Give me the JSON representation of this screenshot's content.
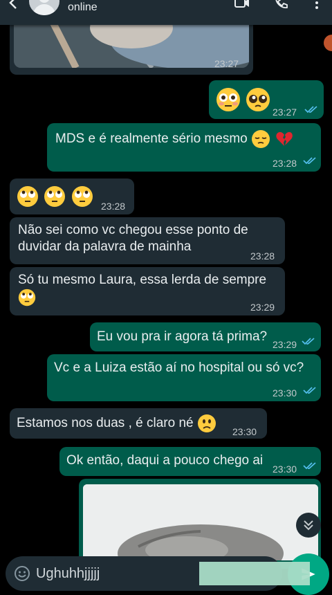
{
  "header": {
    "status": "online"
  },
  "colors": {
    "incoming_bubble": "#1f2c34",
    "outgoing_bubble": "#005c4b",
    "read_ticks": "#53bdeb",
    "background": "#000000"
  },
  "messages": [
    {
      "direction": "in",
      "type": "image",
      "time": "23:27"
    },
    {
      "direction": "out",
      "type": "emoji",
      "text": "",
      "emojis": [
        "flushed-face",
        "pleading-face"
      ],
      "time": "23:27",
      "status": "read"
    },
    {
      "direction": "out",
      "type": "text",
      "text": "MDS e é realmente sério mesmo",
      "emojis": [
        "pensive-face",
        "broken-heart"
      ],
      "time": "23:28",
      "status": "read"
    },
    {
      "direction": "in",
      "type": "emoji",
      "emojis": [
        "face-with-rolling-eyes",
        "face-with-rolling-eyes",
        "face-with-rolling-eyes"
      ],
      "time": "23:28"
    },
    {
      "direction": "in",
      "type": "text",
      "text": "Não sei como vc chegou esse ponto de duvidar da palavra de mainha",
      "time": "23:28"
    },
    {
      "direction": "in",
      "type": "text",
      "text": "Só tu mesmo Laura,  essa lerda de sempre",
      "emojis": [
        "face-with-rolling-eyes"
      ],
      "time": "23:29"
    },
    {
      "direction": "out",
      "type": "text",
      "text": "Eu vou pra ir agora tá prima?",
      "time": "23:29",
      "status": "read"
    },
    {
      "direction": "out",
      "type": "text",
      "text": "Vc e a Luiza estão aí no hospital ou só vc?",
      "time": "23:30",
      "status": "read"
    },
    {
      "direction": "in",
      "type": "text",
      "text": "Estamos nos duas , é claro né",
      "emojis": [
        "slightly-frowning-face"
      ],
      "time": "23:30"
    },
    {
      "direction": "out",
      "type": "text",
      "text": "Ok então, daqui a pouco chego ai",
      "time": "23:30",
      "status": "read"
    },
    {
      "direction": "out",
      "type": "image"
    }
  ],
  "composer": {
    "value": "Ughuhhjjjjj"
  },
  "icons": [
    "back-arrow-icon",
    "avatar",
    "video-call-icon",
    "voice-call-icon",
    "more-options-icon",
    "double-check-icon",
    "scroll-down-icon",
    "emoji-icon",
    "send-icon"
  ]
}
